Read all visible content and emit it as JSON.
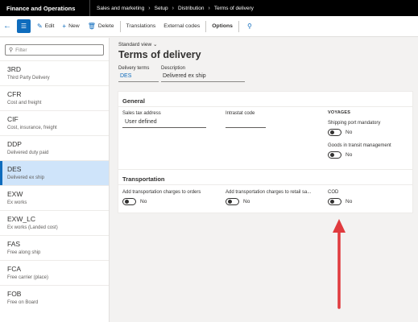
{
  "app": {
    "title": "Finance and Operations"
  },
  "breadcrumb": [
    "Sales and marketing",
    "Setup",
    "Distribution",
    "Terms of delivery"
  ],
  "toolbar": {
    "edit": "Edit",
    "new": "New",
    "delete": "Delete",
    "translations": "Translations",
    "external_codes": "External codes",
    "options": "Options"
  },
  "list": {
    "filter_placeholder": "Filter",
    "items": [
      {
        "code": "3RD",
        "desc": "Third Party Delivery"
      },
      {
        "code": "CFR",
        "desc": "Cost and freight"
      },
      {
        "code": "CIF",
        "desc": "Cost, insurance, freight"
      },
      {
        "code": "DDP",
        "desc": "Delivered duty paid"
      },
      {
        "code": "DES",
        "desc": "Delivered ex ship",
        "selected": true
      },
      {
        "code": "EXW",
        "desc": "Ex works"
      },
      {
        "code": "EXW_LC",
        "desc": "Ex works (Landed cost)"
      },
      {
        "code": "FAS",
        "desc": "Free along ship"
      },
      {
        "code": "FCA",
        "desc": "Free carrier (place)"
      },
      {
        "code": "FOB",
        "desc": "Free on Board"
      }
    ]
  },
  "detail": {
    "view": "Standard view",
    "title": "Terms of delivery",
    "delivery_terms_label": "Delivery terms",
    "delivery_terms_value": "DES",
    "description_label": "Description",
    "description_value": "Delivered ex ship",
    "general": {
      "title": "General",
      "sales_tax_label": "Sales tax address",
      "sales_tax_value": "User defined",
      "intrastat_label": "Intrastat code",
      "intrastat_value": "",
      "voyages_title": "VOYAGES",
      "shipping_port_label": "Shipping port mandatory",
      "shipping_port_value": "No",
      "goods_transit_label": "Goods in transit management",
      "goods_transit_value": "No"
    },
    "transportation": {
      "title": "Transportation",
      "add_orders_label": "Add transportation charges to orders",
      "add_orders_value": "No",
      "add_retail_label": "Add transportation charges to retail sa...",
      "add_retail_value": "No",
      "cod_label": "COD",
      "cod_value": "No"
    }
  },
  "colors": {
    "accent": "#0f6cbd",
    "annotation_arrow": "#e03a3e",
    "selected_bg": "#cfe4fa"
  }
}
